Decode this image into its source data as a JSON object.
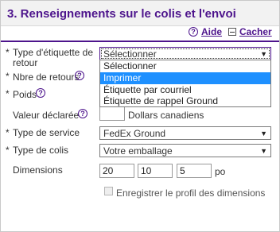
{
  "header": {
    "title": "3. Renseignements sur le colis et l'envoi"
  },
  "toolbar": {
    "help_label": "Aide",
    "hide_label": "Cacher"
  },
  "form": {
    "label_type": {
      "required_mark": "*",
      "label_line1": "Type d'étiquette de",
      "label_line2": "retour",
      "selected": "Sélectionner"
    },
    "return_count": {
      "required_mark": "*",
      "label": "Nbre de retours"
    },
    "weight": {
      "required_mark": "*",
      "label": "Poids"
    },
    "declared_value": {
      "label": "Valeur déclarée",
      "value": "",
      "unit": "Dollars canadiens"
    },
    "service_type": {
      "required_mark": "*",
      "label": "Type de service",
      "selected": "FedEx Ground"
    },
    "package_type": {
      "required_mark": "*",
      "label": "Type de colis",
      "selected": "Votre emballage"
    },
    "dimensions": {
      "label": "Dimensions",
      "length": "20",
      "width": "10",
      "height": "5",
      "unit": "po"
    },
    "save_profile": {
      "label": "Enregistrer le profil des dimensions",
      "checked": false
    }
  },
  "dropdown": {
    "options": [
      "Sélectionner",
      "Imprimer",
      "Étiquette par courriel",
      "Étiquette de rappel Ground"
    ],
    "highlighted_index": 1
  },
  "colors": {
    "brand_purple": "#4d148c",
    "highlight_blue": "#1e90ff",
    "header_bg": "#f2f2f2"
  }
}
